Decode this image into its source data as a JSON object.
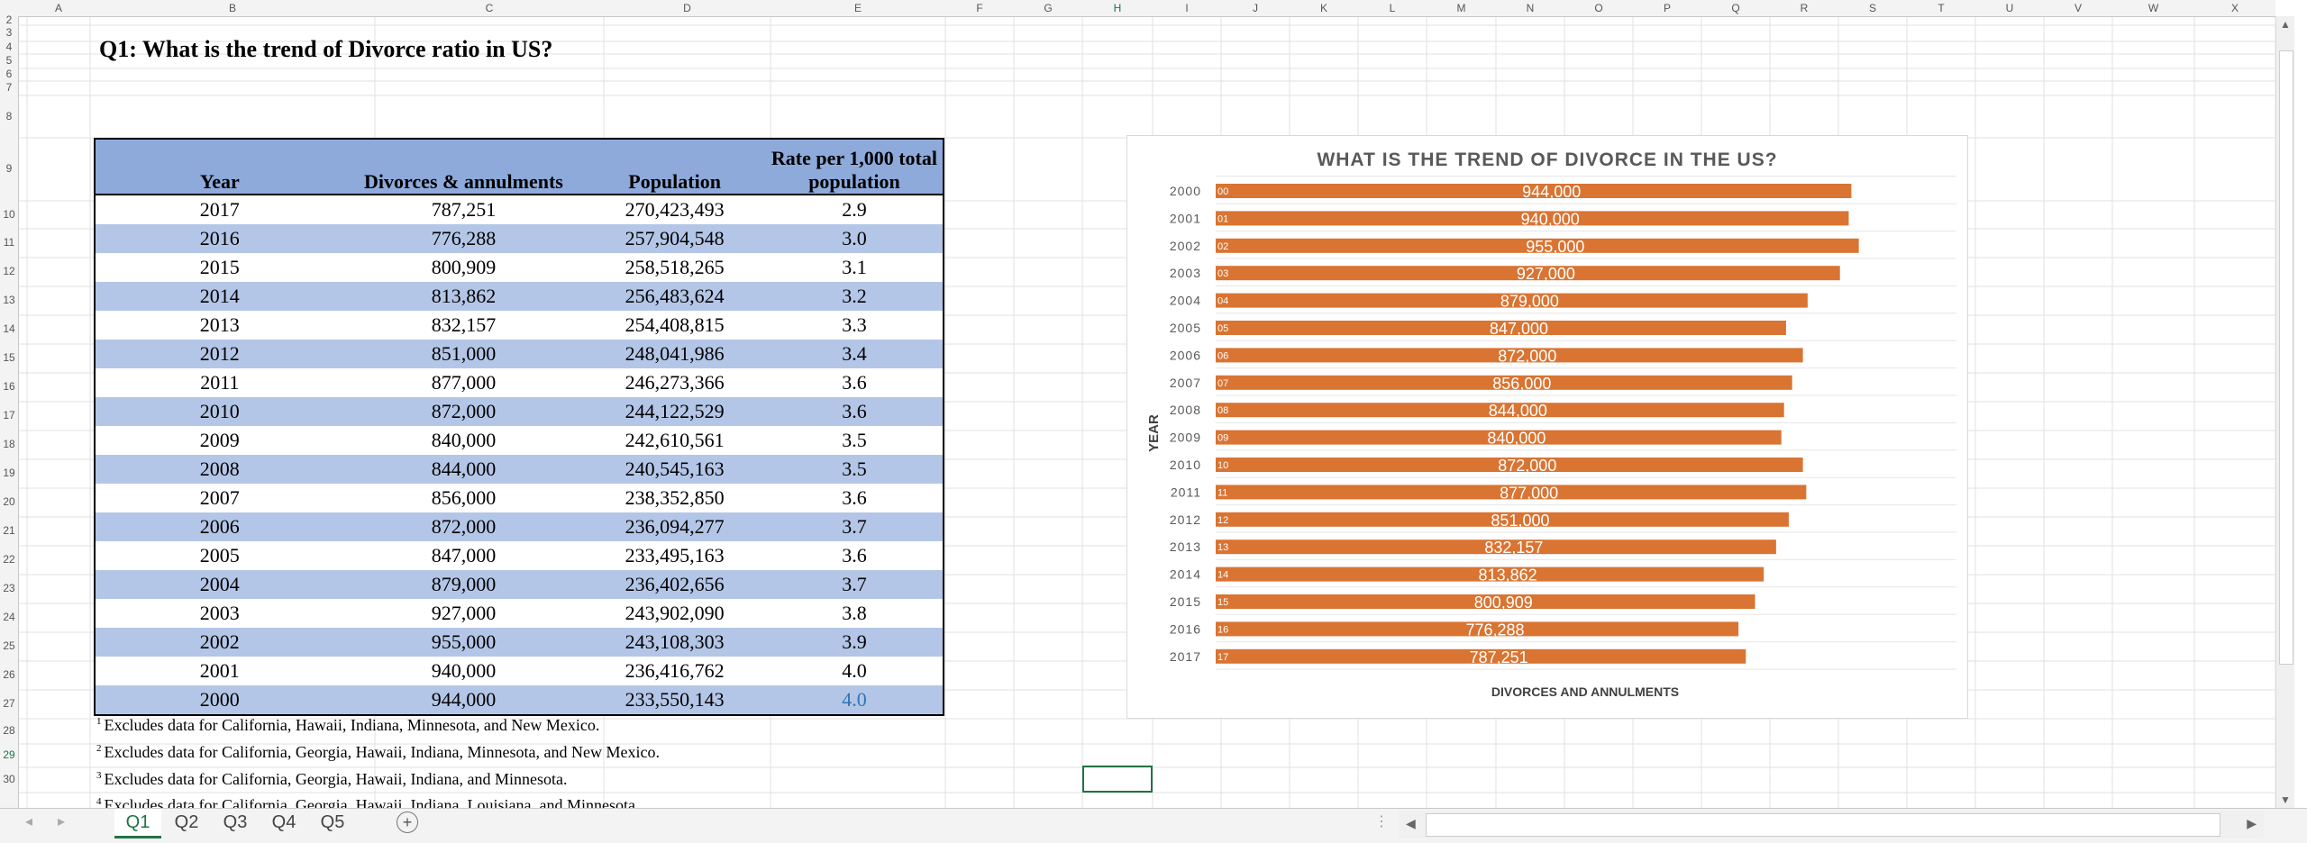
{
  "sheet": {
    "title": "Q1:  What is the trend of Divorce ratio in US?",
    "columns": [
      "A",
      "B",
      "C",
      "D",
      "E",
      "F",
      "G",
      "H",
      "I",
      "J",
      "K",
      "L",
      "M",
      "N",
      "O",
      "P",
      "Q",
      "R",
      "S",
      "T",
      "U",
      "V",
      "W",
      "X"
    ],
    "rows": [
      "2",
      "3",
      "4",
      "5",
      "6",
      "7",
      "8",
      "9",
      "10",
      "11",
      "12",
      "13",
      "14",
      "15",
      "16",
      "17",
      "18",
      "19",
      "20",
      "21",
      "22",
      "23",
      "24",
      "25",
      "26",
      "27",
      "28",
      "29",
      "30"
    ]
  },
  "table": {
    "headers": [
      "Year",
      "Divorces & annulments",
      "Population",
      "Rate per 1,000 total population"
    ],
    "rows": [
      [
        "2017",
        "787,251",
        "270,423,493",
        "2.9"
      ],
      [
        "2016",
        "776,288",
        "257,904,548",
        "3.0"
      ],
      [
        "2015",
        "800,909",
        "258,518,265",
        "3.1"
      ],
      [
        "2014",
        "813,862",
        "256,483,624",
        "3.2"
      ],
      [
        "2013",
        "832,157",
        "254,408,815",
        "3.3"
      ],
      [
        "2012",
        "851,000",
        "248,041,986",
        "3.4"
      ],
      [
        "2011",
        "877,000",
        "246,273,366",
        "3.6"
      ],
      [
        "2010",
        "872,000",
        "244,122,529",
        "3.6"
      ],
      [
        "2009",
        "840,000",
        "242,610,561",
        "3.5"
      ],
      [
        "2008",
        "844,000",
        "240,545,163",
        "3.5"
      ],
      [
        "2007",
        "856,000",
        "238,352,850",
        "3.6"
      ],
      [
        "2006",
        "872,000",
        "236,094,277",
        "3.7"
      ],
      [
        "2005",
        "847,000",
        "233,495,163",
        "3.6"
      ],
      [
        "2004",
        "879,000",
        "236,402,656",
        "3.7"
      ],
      [
        "2003",
        "927,000",
        "243,902,090",
        "3.8"
      ],
      [
        "2002",
        "955,000",
        "243,108,303",
        "3.9"
      ],
      [
        "2001",
        "940,000",
        "236,416,762",
        "4.0"
      ],
      [
        "2000",
        "944,000",
        "233,550,143",
        "4.0"
      ]
    ]
  },
  "footnotes": [
    {
      "mark": "1",
      "text": "Excludes data for California, Hawaii, Indiana, Minnesota, and New Mexico."
    },
    {
      "mark": "2",
      "text": "Excludes data for California, Georgia, Hawaii, Indiana, Minnesota, and New Mexico."
    },
    {
      "mark": "3",
      "text": "Excludes data for California, Georgia, Hawaii, Indiana, and Minnesota."
    },
    {
      "mark": "4",
      "text": "Excludes data for California, Georgia, Hawaii, Indiana, Louisiana, and Minnesota."
    }
  ],
  "tabs": [
    "Q1",
    "Q2",
    "Q3",
    "Q4",
    "Q5"
  ],
  "active_tab": "Q1",
  "colors": {
    "bar": "#d97432",
    "header_blue": "#8eaadb",
    "band_blue": "#b4c6e7",
    "excel_green": "#217346"
  },
  "chart_data": {
    "type": "bar",
    "orientation": "horizontal",
    "title": "WHAT IS THE TREND OF DIVORCE IN THE US?",
    "xlabel": "DIVORCES AND ANNULMENTS",
    "ylabel": "YEAR",
    "categories": [
      "2000",
      "2001",
      "2002",
      "2003",
      "2004",
      "2005",
      "2006",
      "2007",
      "2008",
      "2009",
      "2010",
      "2011",
      "2012",
      "2013",
      "2014",
      "2015",
      "2016",
      "2017"
    ],
    "bar_labels": [
      "00",
      "01",
      "02",
      "03",
      "04",
      "05",
      "06",
      "07",
      "08",
      "09",
      "10",
      "11",
      "12",
      "13",
      "14",
      "15",
      "16",
      "17"
    ],
    "values": [
      944000,
      940000,
      955000,
      927000,
      879000,
      847000,
      872000,
      856000,
      844000,
      840000,
      872000,
      877000,
      851000,
      832157,
      813862,
      800909,
      776288,
      787251
    ],
    "data_labels": [
      "944,000",
      "940,000",
      "955,000",
      "927,000",
      "879,000",
      "847,000",
      "872,000",
      "856,000",
      "844,000",
      "840,000",
      "872,000",
      "877,000",
      "851,000",
      "832,157",
      "813,862",
      "800,909",
      "776,288",
      "787,251"
    ],
    "grid": true,
    "legend": "none"
  }
}
